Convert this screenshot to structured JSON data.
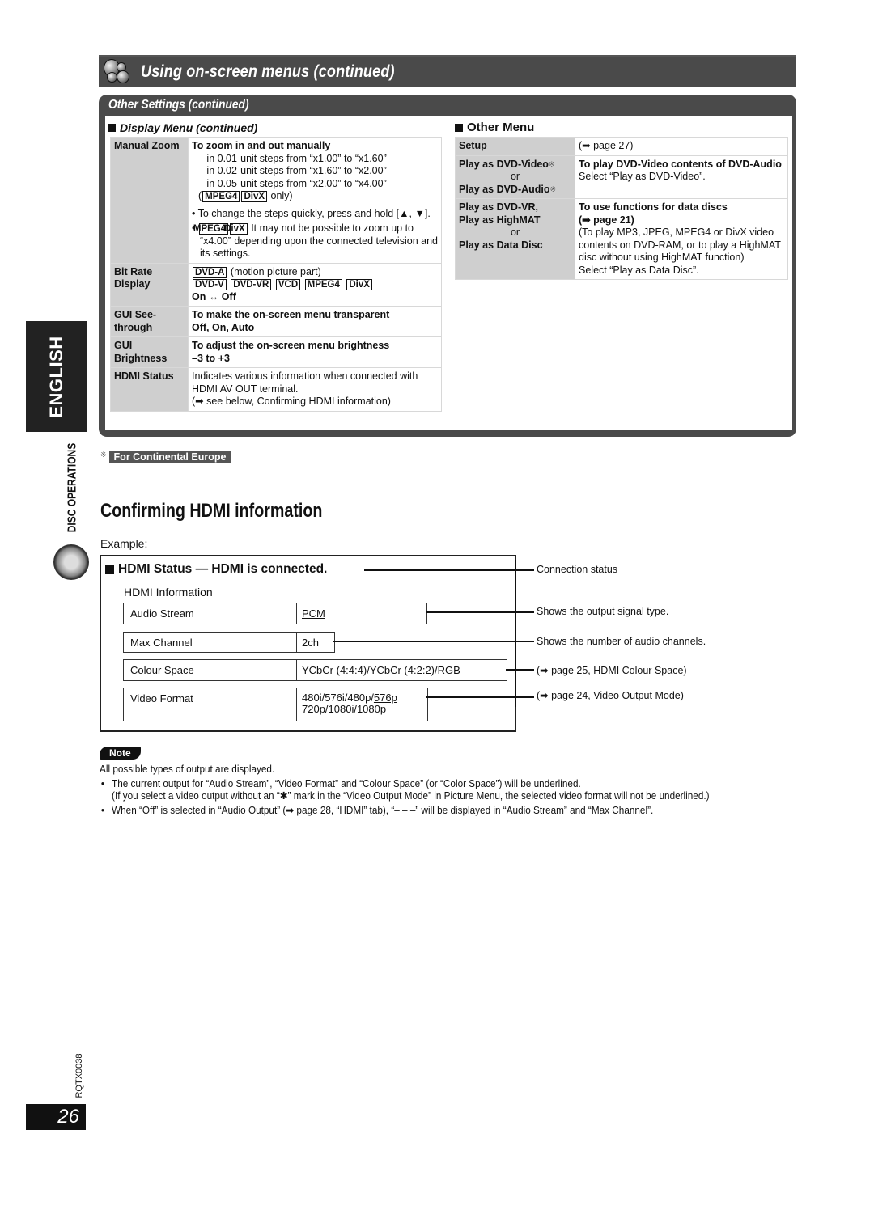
{
  "header": {
    "title": "Using on-screen menus (continued)",
    "icon": "disc-balls-icon"
  },
  "settings": {
    "frame_title": "Other Settings (continued)",
    "display_menu": {
      "heading": "Display Menu (continued)",
      "rows": [
        {
          "key": "Manual Zoom",
          "title": "To zoom in and out manually",
          "steps": [
            "– in 0.01-unit steps from “x1.00” to “x1.60”",
            "– in 0.02-unit steps from “x1.60” to “x2.00”",
            "– in 0.05-unit steps from “x2.00” to “x4.00”"
          ],
          "steps_tags": [
            "MPEG4",
            "DivX"
          ],
          "steps_tags_suffix": "only)",
          "bullet1": "To change the steps quickly, press and hold [▲, ▼].",
          "bullet2_tags": [
            "MPEG4",
            "DivX"
          ],
          "bullet2": "It may not be possible to zoom up to “x4.00” depending upon the connected television and its settings."
        },
        {
          "key": "Bit Rate Display",
          "tag_a": "DVD-A",
          "tag_a_note": "(motion picture part)",
          "tags": [
            "DVD-V",
            "DVD-VR",
            "VCD",
            "MPEG4",
            "DivX"
          ],
          "value": "On ↔ Off"
        },
        {
          "key": "GUI See-through",
          "title": "To make the on-screen menu transparent",
          "value": "Off, On, Auto"
        },
        {
          "key": "GUI Brightness",
          "title": "To adjust the on-screen menu brightness",
          "value": "–3 to +3"
        },
        {
          "key": "HDMI Status",
          "line1": "Indicates various information when connected with HDMI AV OUT terminal.",
          "line2": "(➡ see below, Confirming HDMI information)"
        }
      ]
    },
    "other_menu": {
      "heading": "Other Menu",
      "rows": [
        {
          "key": "Setup",
          "value": "(➡ page 27)"
        },
        {
          "key1": "Play as DVD-Video",
          "or": "or",
          "key2": "Play as DVD-Audio",
          "mark": "※",
          "title": "To play DVD-Video contents of DVD-Audio",
          "value": "Select “Play as DVD-Video”."
        },
        {
          "key1": "Play as DVD-VR,",
          "key2": "Play as HighMAT",
          "or": "or",
          "key3": "Play as Data Disc",
          "title": "To use functions for data discs",
          "ref": "(➡ page 21)",
          "desc": "(To play MP3, JPEG, MPEG4 or DivX video contents on DVD-RAM, or to play a HighMAT disc without using HighMAT function)",
          "value": "Select “Play as Data Disc”."
        }
      ]
    }
  },
  "footnote": {
    "mark": "※",
    "label": "For Continental Europe"
  },
  "side": {
    "language": "ENGLISH",
    "section": "DISC OPERATIONS",
    "section_icon": "disc-icon"
  },
  "hdmi": {
    "title": "Confirming HDMI information",
    "example_label": "Example:",
    "status_heading": "HDMI Status — HDMI is connected.",
    "info_label": "HDMI Information",
    "rows": [
      {
        "label": "Audio Stream",
        "value_underlined": "PCM",
        "value_rest": "",
        "callout": "Shows the output signal type."
      },
      {
        "label": "Max Channel",
        "value_underlined": "",
        "value_rest": "2ch",
        "callout": "Shows the number of audio channels."
      },
      {
        "label": "Colour Space",
        "value_underlined": "YCbCr (4:4:4)",
        "value_rest": "/YCbCr (4:2:2)/RGB",
        "callout": "(➡ page 25, HDMI Colour Space)"
      },
      {
        "label": "Video Format",
        "value_line1_plain": "480i/576i/480p/",
        "value_underlined": "576p",
        "value_line2": "720p/1080i/1080p",
        "callout": "(➡ page 24, Video Output Mode)"
      }
    ],
    "status_callout": "Connection status"
  },
  "note": {
    "badge": "Note",
    "intro": "All possible types of output are displayed.",
    "bullets": [
      {
        "text": "The current output for “Audio Stream”, “Video Format” and “Colour Space” (or “Color Space”) will be underlined.",
        "sub": "(If you select a video output without an “✱” mark in the “Video Output Mode” in Picture Menu, the selected video format will not be underlined.)"
      },
      {
        "text": "When “Off” is selected in “Audio Output” (➡ page 28, “HDMI” tab), “– – –” will be displayed in “Audio Stream” and “Max Channel”."
      }
    ]
  },
  "footer": {
    "doc_code": "RQTX0038",
    "page_number": "26"
  }
}
